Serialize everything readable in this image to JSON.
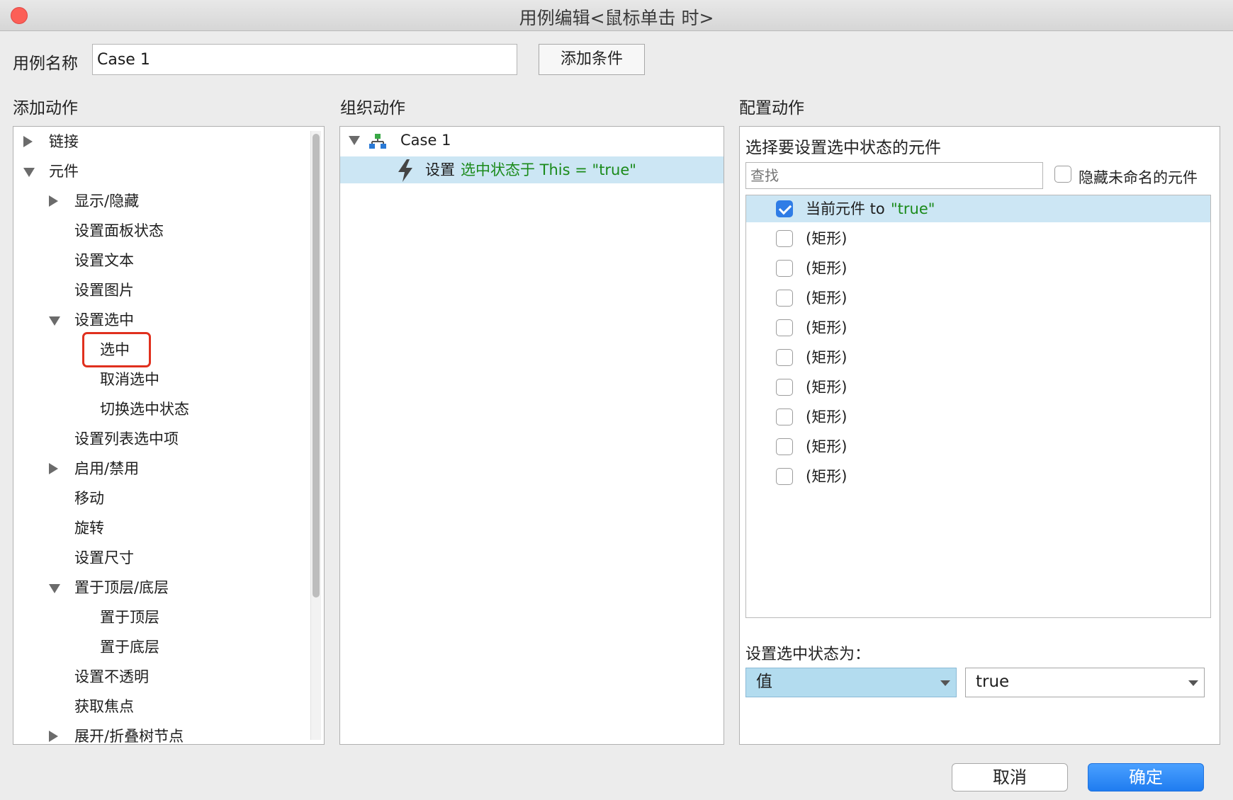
{
  "window": {
    "title": "用例编辑<鼠标单击 时>"
  },
  "case_name": {
    "label": "用例名称",
    "value": "Case 1",
    "add_condition": "添加条件"
  },
  "sections": {
    "add": "添加动作",
    "organize": "组织动作",
    "configure": "配置动作"
  },
  "add_tree": [
    {
      "label": "链接",
      "expander": "right"
    },
    {
      "label": "元件",
      "expander": "down"
    },
    {
      "label": "显示/隐藏",
      "expander": "right"
    },
    {
      "label": "设置面板状态",
      "expander": ""
    },
    {
      "label": "设置文本",
      "expander": ""
    },
    {
      "label": "设置图片",
      "expander": ""
    },
    {
      "label": "设置选中",
      "expander": "down"
    },
    {
      "label": "选中",
      "expander": "",
      "highlighted": true
    },
    {
      "label": "取消选中",
      "expander": ""
    },
    {
      "label": "切换选中状态",
      "expander": ""
    },
    {
      "label": "设置列表选中项",
      "expander": ""
    },
    {
      "label": "启用/禁用",
      "expander": "right"
    },
    {
      "label": "移动",
      "expander": ""
    },
    {
      "label": "旋转",
      "expander": ""
    },
    {
      "label": "设置尺寸",
      "expander": ""
    },
    {
      "label": "置于顶层/底层",
      "expander": "down"
    },
    {
      "label": "置于顶层",
      "expander": ""
    },
    {
      "label": "置于底层",
      "expander": ""
    },
    {
      "label": "设置不透明",
      "expander": ""
    },
    {
      "label": "获取焦点",
      "expander": ""
    },
    {
      "label": "展开/折叠树节点",
      "expander": "right"
    }
  ],
  "organize": {
    "case_label": "Case 1",
    "action_prefix": "设置",
    "action_detail": "选中状态于 This = \"true\""
  },
  "configure": {
    "heading": "选择要设置选中状态的元件",
    "search_placeholder": "查找",
    "hide_unnamed": "隐藏未命名的元件",
    "widgets": [
      {
        "label": "当前元件 to",
        "value": "\"true\"",
        "checked": true
      },
      {
        "label": "(矩形)",
        "checked": false
      },
      {
        "label": "(矩形)",
        "checked": false
      },
      {
        "label": "(矩形)",
        "checked": false
      },
      {
        "label": "(矩形)",
        "checked": false
      },
      {
        "label": "(矩形)",
        "checked": false
      },
      {
        "label": "(矩形)",
        "checked": false
      },
      {
        "label": "(矩形)",
        "checked": false
      },
      {
        "label": "(矩形)",
        "checked": false
      },
      {
        "label": "(矩形)",
        "checked": false
      }
    ],
    "set_state_label": "设置选中状态为：",
    "mode": "值",
    "value": "true"
  },
  "footer": {
    "cancel": "取消",
    "ok": "确定"
  },
  "colors": {
    "accent": "#2f7ce6",
    "selection": "#cce6f4",
    "green_text": "#1a8a1a",
    "highlight": "#e0301e"
  }
}
